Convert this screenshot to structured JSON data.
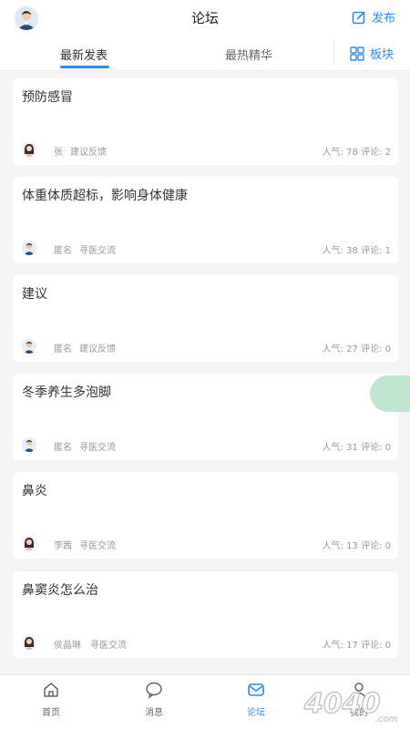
{
  "header": {
    "title": "论坛",
    "publish_label": "发布"
  },
  "tabs": [
    {
      "label": "最新发表",
      "active": true
    },
    {
      "label": "最热精华",
      "active": false
    }
  ],
  "blocks_label": "板块",
  "posts": [
    {
      "title": "预防感冒",
      "author": "张",
      "category": "建议反馈",
      "stats": "人气: 78  评论: 2",
      "avatar": "female-avatar"
    },
    {
      "title": "体重体质超标，影响身体健康",
      "author": "匿名",
      "category": "寻医交流",
      "stats": "人气: 38  评论: 1",
      "avatar": "male-avatar"
    },
    {
      "title": "建议",
      "author": "匿名",
      "category": "建议反馈",
      "stats": "人气: 27  评论: 0",
      "avatar": "male-avatar"
    },
    {
      "title": "冬季养生多泡脚",
      "author": "匿名",
      "category": "寻医交流",
      "stats": "人气: 31  评论: 0",
      "avatar": "male-avatar"
    },
    {
      "title": "鼻炎",
      "author": "李茜",
      "category": "寻医交流",
      "stats": "人气: 13  评论: 0",
      "avatar": "female-avatar"
    },
    {
      "title": "鼻窦炎怎么治",
      "author": "侯晶琳",
      "category": "寻医交流",
      "stats": "人气: 17  评论: 0",
      "avatar": "female-avatar"
    }
  ],
  "bottom_nav": [
    {
      "label": "首页",
      "icon": "home-icon",
      "active": false
    },
    {
      "label": "消息",
      "icon": "chat-icon",
      "active": false
    },
    {
      "label": "论坛",
      "icon": "mail-icon",
      "active": true
    },
    {
      "label": "我的",
      "icon": "user-icon",
      "active": false
    }
  ],
  "watermark_text": "4040.com",
  "colors": {
    "accent": "#2d8cf0",
    "background": "#f4f4f4",
    "fab": "#b8e3cb"
  }
}
